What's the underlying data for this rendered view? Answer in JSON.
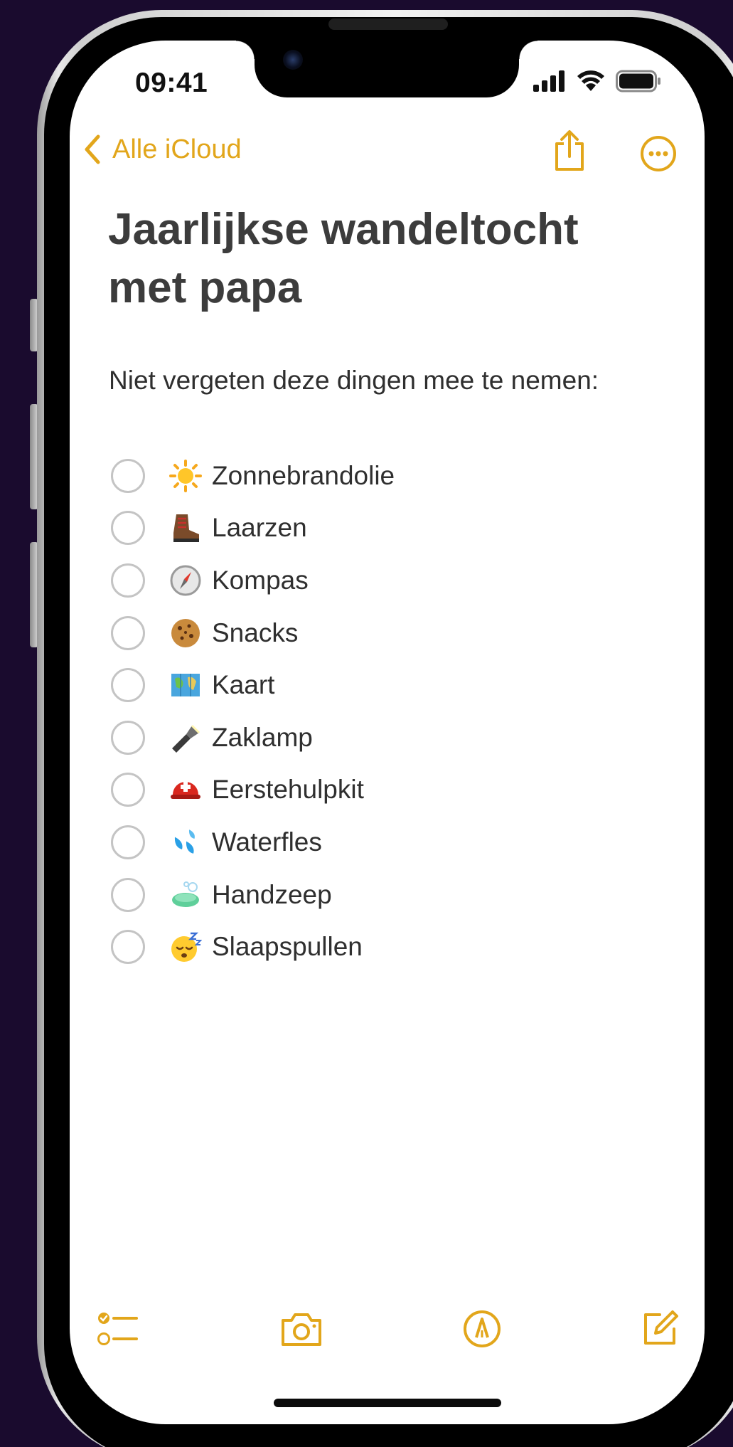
{
  "status_bar": {
    "time": "09:41"
  },
  "nav": {
    "back_label": "Alle iCloud"
  },
  "note": {
    "title": "Jaarlijkse wandeltocht met papa",
    "intro": "Niet vergeten deze dingen mee te nemen:",
    "items": [
      {
        "emoji": "sun-icon",
        "label": "Zonnebrandolie",
        "checked": false
      },
      {
        "emoji": "hiking-boot-icon",
        "label": "Laarzen",
        "checked": false
      },
      {
        "emoji": "compass-icon",
        "label": "Kompas",
        "checked": false
      },
      {
        "emoji": "cookie-icon",
        "label": "Snacks",
        "checked": false
      },
      {
        "emoji": "map-icon",
        "label": "Kaart",
        "checked": false
      },
      {
        "emoji": "flashlight-icon",
        "label": "Zaklamp",
        "checked": false
      },
      {
        "emoji": "rescue-helmet-icon",
        "label": "Eerstehulpkit",
        "checked": false
      },
      {
        "emoji": "water-drops-icon",
        "label": "Waterfles",
        "checked": false
      },
      {
        "emoji": "soap-icon",
        "label": "Handzeep",
        "checked": false
      },
      {
        "emoji": "sleeping-face-icon",
        "label": "Slaapspullen",
        "checked": false
      }
    ]
  },
  "colors": {
    "accent": "#e2a61b",
    "background": "#1a0b2e",
    "text": "#2f2f2f"
  }
}
